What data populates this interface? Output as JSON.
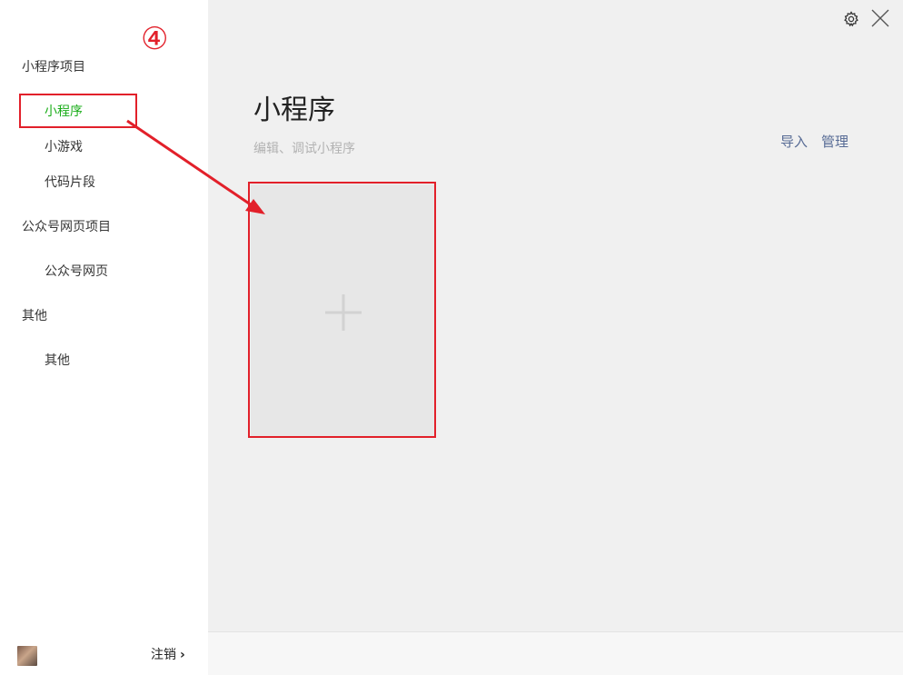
{
  "sidebar": {
    "sections": [
      {
        "title": "小程序项目",
        "items": [
          "小程序",
          "小游戏",
          "代码片段"
        ]
      },
      {
        "title": "公众号网页项目",
        "items": [
          "公众号网页"
        ]
      },
      {
        "title": "其他",
        "items": [
          "其他"
        ]
      }
    ],
    "active_item": "小程序",
    "footer": {
      "logout_label": "注销",
      "chevron": "›"
    }
  },
  "annotation": {
    "step_number": "④",
    "color": "#e2202a"
  },
  "main": {
    "title": "小程序",
    "subtitle": "编辑、调试小程序",
    "actions": {
      "import_label": "导入",
      "manage_label": "管理"
    },
    "add_card_icon": "plus-icon"
  },
  "window": {
    "settings_icon": "gear-icon",
    "close_icon": "close-icon"
  },
  "colors": {
    "active_green": "#1aad19",
    "link_blue": "#576b95",
    "annotation_red": "#e2202a"
  }
}
